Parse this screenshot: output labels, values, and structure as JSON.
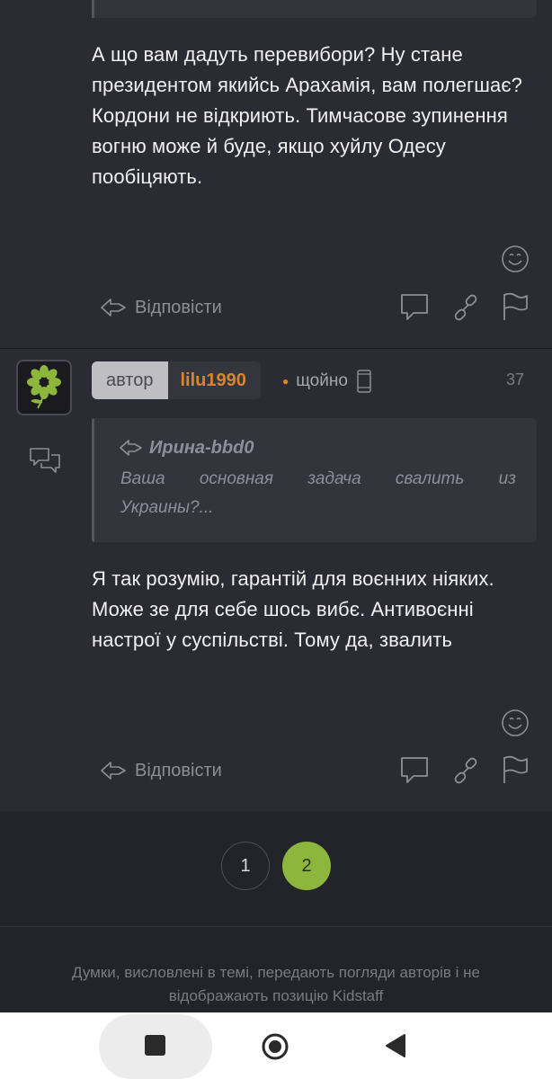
{
  "post1": {
    "text_lines": [
      "А що вам дадуть перевибори? Ну стане президентом якийсь Арахамія, вам полегшає?",
      "Кордони не відкриють. Тимчасове зупинення вогню може й буде, якщо хуйлу Одесу пообіцяють."
    ],
    "reply_label": "Відповісти"
  },
  "post2": {
    "role_badge": "автор",
    "username": "lilu1990",
    "time": "щойно",
    "post_number": "37",
    "quote": {
      "author": "Ирина-bbd0",
      "text": "Ваша основная задача свалить из Украины?..."
    },
    "text": "Я так розумію, гарантій для воєнних ніяких. Може зе для себе шось вибє. Антивоєнні настрої у суспільстві. Тому да, звалить",
    "reply_label": "Відповісти"
  },
  "pagination": {
    "pages": [
      "1",
      "2"
    ],
    "current": "2"
  },
  "footer": {
    "disclaimer": "Думки, висловлені в темі, передають погляди авторів і не відображають позицію Kidstaff"
  },
  "colors": {
    "accent_green": "#8db63c",
    "username_orange": "#d9852a",
    "background": "#23232a",
    "post_bg": "#2b2b33"
  },
  "icons": {
    "emoji": "smiley-icon",
    "reply": "reply-arrow-icon",
    "comment": "comment-icon",
    "link": "link-icon",
    "flag": "flag-icon",
    "mobile": "mobile-phone-icon",
    "chat": "chat-bubbles-icon"
  }
}
